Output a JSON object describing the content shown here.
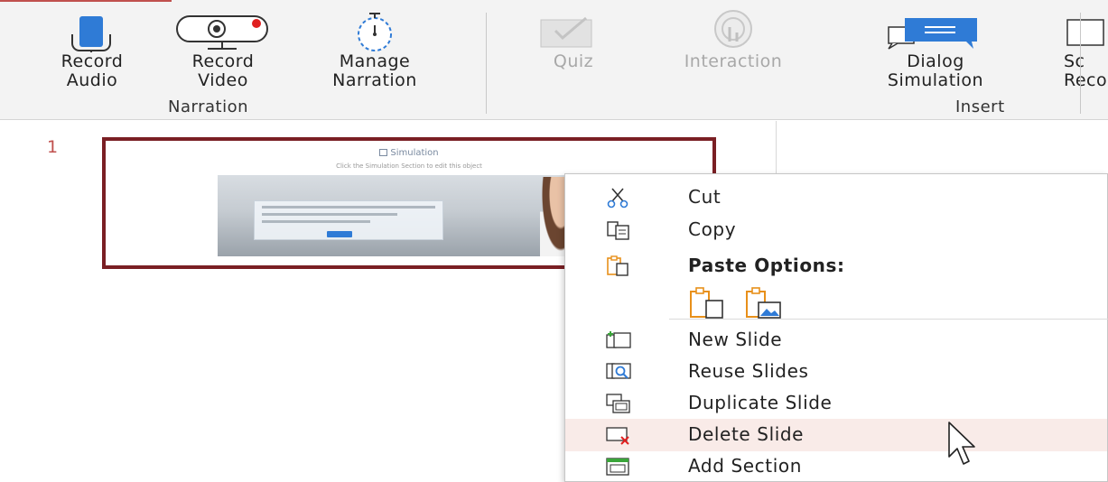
{
  "ribbon": {
    "groups": [
      {
        "label": "Narration"
      },
      {
        "label": "Insert"
      }
    ],
    "buttons": {
      "record_audio": "Record\nAudio",
      "record_video": "Record\nVideo",
      "manage_narration": "Manage\nNarration",
      "quiz": "Quiz",
      "interaction": "Interaction",
      "dialog_simulation": "Dialog\nSimulation",
      "screen_recording": "Sc\nReco"
    }
  },
  "slides": [
    {
      "number": "1",
      "title": "Simulation",
      "subtitle": "Click the Simulation Section to edit this object"
    }
  ],
  "context_menu": {
    "items": [
      {
        "label": "Cut",
        "icon": "scissors-icon"
      },
      {
        "label": "Copy",
        "icon": "copy-icon"
      },
      {
        "label": "Paste Options:",
        "icon": "paste-icon"
      },
      {
        "label": "New Slide",
        "icon": "new-slide-icon"
      },
      {
        "label": "Reuse Slides",
        "icon": "reuse-slides-icon"
      },
      {
        "label": "Duplicate Slide",
        "icon": "duplicate-slide-icon"
      },
      {
        "label": "Delete Slide",
        "icon": "delete-slide-icon"
      },
      {
        "label": "Add Section",
        "icon": "add-section-icon"
      }
    ],
    "paste_options": [
      {
        "icon": "paste-keep-source-icon"
      },
      {
        "icon": "paste-picture-icon"
      }
    ],
    "hovered_item": "Delete Slide"
  },
  "colors": {
    "accent_red": "#c0504d",
    "slide_border": "#7a1f24",
    "icon_blue": "#2f7bd6",
    "paste_orange": "#e8901a",
    "hover_bg": "#f9ebe8"
  }
}
